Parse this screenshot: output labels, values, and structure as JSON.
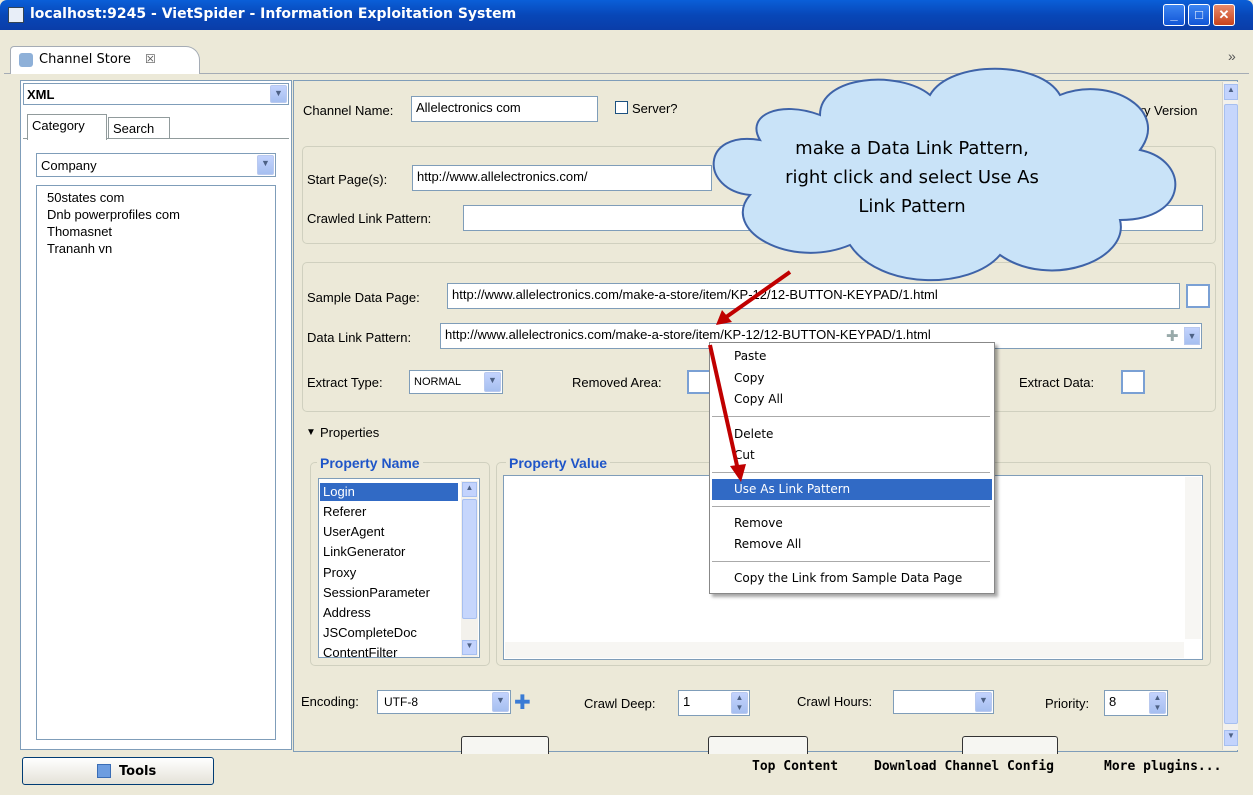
{
  "window": {
    "title": "localhost:9245 - VietSpider - Information Exploitation System"
  },
  "tab": {
    "label": "Channel Store",
    "close": "☒"
  },
  "tabbar": {
    "chevron": "»"
  },
  "left": {
    "format_combo": "XML",
    "tabs": [
      "Category",
      "Search"
    ],
    "category_combo": "Company",
    "items": [
      "50states com",
      "Dnb powerprofiles com",
      "Thomasnet",
      "Trananh vn"
    ],
    "tools_button": "Tools"
  },
  "form": {
    "channel_name_label": "Channel Name:",
    "channel_name_value": "Allelectronics com",
    "server_label": "Server?",
    "history_version": "History Version",
    "start_pages_label": "Start Page(s):",
    "start_pages_value": "http://www.allelectronics.com/",
    "crawled_link_label": "Crawled Link Pattern:",
    "sample_data_label": "Sample Data Page:",
    "sample_data_value": "http://www.allelectronics.com/make-a-store/item/KP-12/12-BUTTON-KEYPAD/1.html",
    "data_link_label": "Data Link Pattern:",
    "data_link_value": "http://www.allelectronics.com/make-a-store/item/KP-12/12-BUTTON-KEYPAD/1.html",
    "extract_type_label": "Extract Type:",
    "extract_type_value": "NORMAL",
    "removed_area_label": "Removed Area:",
    "extract_data_label": "Extract Data:",
    "properties_label": "Properties",
    "property_name_title": "Property Name",
    "property_value_title": "Property Value",
    "property_names": [
      "Login",
      "Referer",
      "UserAgent",
      "LinkGenerator",
      "Proxy",
      "SessionParameter",
      "Address",
      "JSCompleteDoc",
      "ContentFilter"
    ],
    "encoding_label": "Encoding:",
    "encoding_value": "UTF-8",
    "crawl_deep_label": "Crawl Deep:",
    "crawl_deep_value": "1",
    "crawl_hours_label": "Crawl Hours:",
    "crawl_hours_value": "",
    "priority_label": "Priority:",
    "priority_value": "8"
  },
  "context_menu": {
    "items": [
      "Paste",
      "Copy",
      "Copy All",
      "Delete",
      "Cut",
      "Use As Link Pattern",
      "Remove",
      "Remove All",
      "Copy the Link from Sample Data Page"
    ],
    "highlighted": "Use As Link Pattern"
  },
  "callout": {
    "text": "make a Data Link Pattern, right click and select Use As Link Pattern"
  },
  "footer": {
    "links": [
      "Top Content",
      "Download Channel Config",
      "More plugins..."
    ]
  },
  "colors": {
    "titlebar": "#0a5fd8",
    "selection": "#316ac5",
    "section_title": "#1f55c8",
    "arrow": "#c00000",
    "callout_fill": "#c9e3f8"
  }
}
